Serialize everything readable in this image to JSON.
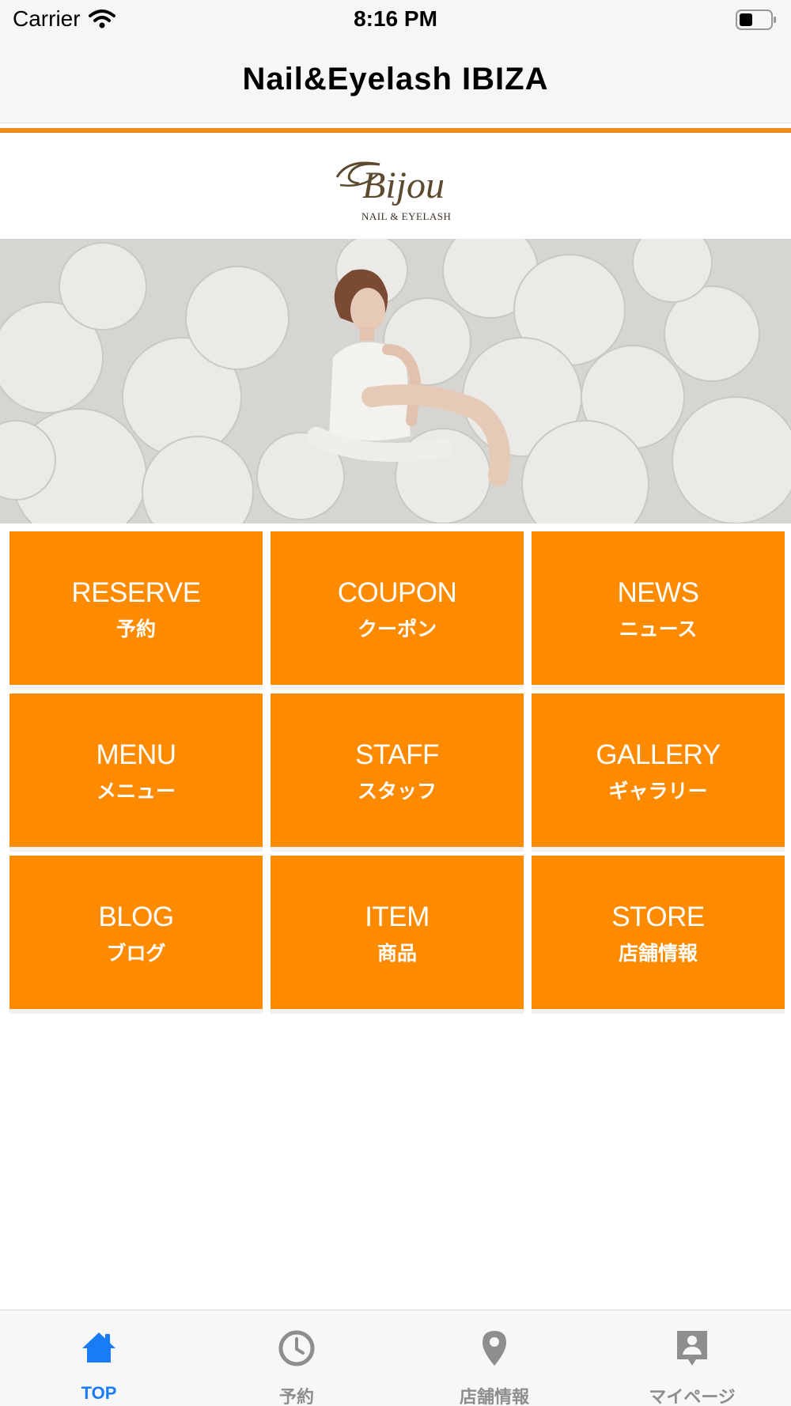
{
  "status_bar": {
    "carrier": "Carrier",
    "time": "8:16 PM"
  },
  "nav": {
    "title": "Nail&Eyelash IBIZA"
  },
  "logo": {
    "brand": "Bijou",
    "tagline": "NAIL & EYELASH"
  },
  "tiles": [
    {
      "en": "RESERVE",
      "jp": "予約"
    },
    {
      "en": "COUPON",
      "jp": "クーポン"
    },
    {
      "en": "NEWS",
      "jp": "ニュース"
    },
    {
      "en": "MENU",
      "jp": "メニュー"
    },
    {
      "en": "STAFF",
      "jp": "スタッフ"
    },
    {
      "en": "GALLERY",
      "jp": "ギャラリー"
    },
    {
      "en": "BLOG",
      "jp": "ブログ"
    },
    {
      "en": "ITEM",
      "jp": "商品"
    },
    {
      "en": "STORE",
      "jp": "店舗情報"
    }
  ],
  "tab_bar": {
    "items": [
      {
        "label": "TOP",
        "icon": "home-icon",
        "active": true
      },
      {
        "label": "予約",
        "icon": "clock-icon",
        "active": false
      },
      {
        "label": "店舗情報",
        "icon": "location-pin-icon",
        "active": false
      },
      {
        "label": "マイページ",
        "icon": "profile-badge-icon",
        "active": false
      }
    ]
  },
  "colors": {
    "accent": "#fe8a00",
    "tab_active": "#1a7cf5",
    "tab_inactive": "#8e8e8e"
  }
}
